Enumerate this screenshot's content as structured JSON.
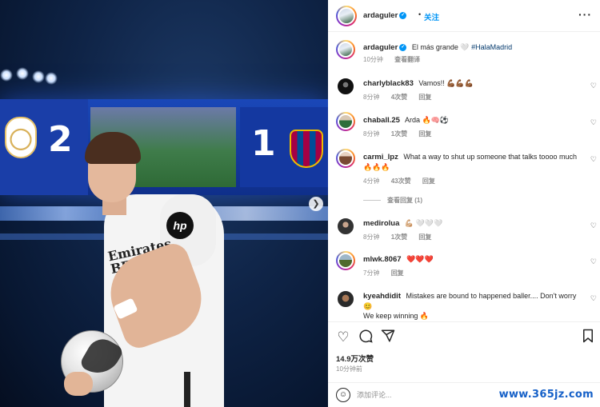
{
  "post": {
    "author": "ardaguler",
    "follow_label": "关注",
    "dot": "•",
    "more_label": "···",
    "caption": {
      "username": "ardaguler",
      "text": "El más grande 🤍",
      "hashtag": "#HalaMadrid",
      "time": "10分钟",
      "translate_label": "查看翻译"
    }
  },
  "scoreboard": {
    "home_score": "2",
    "away_score": "1"
  },
  "player_shirt": {
    "sponsor": "Emirates\nBETTER",
    "logo": "hp"
  },
  "comments": [
    {
      "username": "charlyblack83",
      "text": "Vamos!! 💪🏾💪🏾💪🏾",
      "time": "8分钟",
      "likes": "4次赞",
      "reply": "回复"
    },
    {
      "username": "chaball.25",
      "text": "Arda 🔥🧠⚽",
      "time": "8分钟",
      "likes": "1次赞",
      "reply": "回复"
    },
    {
      "username": "carmi_lpz",
      "text": "What a way to shut up someone that talks toooo much 🔥🔥🔥",
      "time": "4分钟",
      "likes": "43次赞",
      "reply": "回复",
      "view_replies": "查看回复 (1)"
    },
    {
      "username": "medirolua",
      "text": "💪🏼 🤍🤍🤍",
      "time": "8分钟",
      "likes": "1次赞",
      "reply": "回复"
    },
    {
      "username": "mlwk.8067",
      "text": "❤️❤️❤️",
      "time": "7分钟",
      "reply": "回复"
    },
    {
      "username": "kyeahdidit",
      "text": "Mistakes are bound to happened baller.... Don't worry 😊",
      "text2": "We keep winning 🔥"
    }
  ],
  "actions": {
    "like_icon": "heart-icon",
    "comment_icon": "comment-icon",
    "share_icon": "send-icon",
    "save_icon": "bookmark-icon",
    "likes_count": "14.9万次赞",
    "posted_ago": "10分钟前"
  },
  "add_comment": {
    "placeholder": "添加评论..."
  },
  "watermark": "www.365jz.com",
  "colors": {
    "link_blue": "#0095f6",
    "hashtag": "#00376b",
    "secondary_text": "#8e8e8e",
    "real_madrid_blue": "#1a47b8"
  }
}
